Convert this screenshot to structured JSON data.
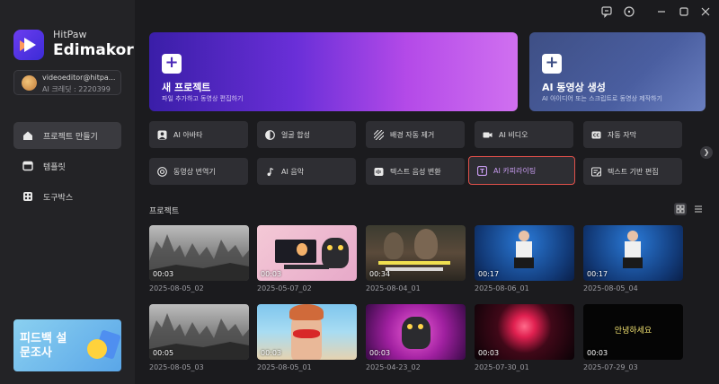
{
  "app": {
    "brand_top": "HitPaw",
    "brand_name": "Edimakor"
  },
  "account": {
    "email": "videoeditor@hitpa...",
    "credits": "AI 크레딧 : 2220399"
  },
  "titlebar": {
    "icons": [
      "feedback-icon",
      "help-icon",
      "minimize-icon",
      "maximize-icon",
      "close-icon"
    ]
  },
  "nav": {
    "items": [
      {
        "label": "프로젝트 만들기",
        "icon": "home-icon",
        "active": true
      },
      {
        "label": "템플릿",
        "icon": "template-icon",
        "active": false
      },
      {
        "label": "도구박스",
        "icon": "toolbox-icon",
        "active": false
      }
    ]
  },
  "feedback_banner": {
    "text": "피드백 설문조사"
  },
  "hero": {
    "new_project": {
      "title": "새 프로젝트",
      "subtitle": "파일 추가하고 동영상 편집하기"
    },
    "ai_video": {
      "title": "AI 동영상 생성",
      "subtitle": "AI 아이디어 또는 스크립트로 동영상 제작하기"
    }
  },
  "tools": {
    "row1": [
      {
        "label": "AI 아바타",
        "icon": "avatar-icon"
      },
      {
        "label": "얼굴 합성",
        "icon": "face-swap-icon"
      },
      {
        "label": "배경 자동 제거",
        "icon": "background-remove-icon"
      },
      {
        "label": "AI 비디오",
        "icon": "ai-video-icon"
      },
      {
        "label": "자동 자막",
        "icon": "caption-icon"
      }
    ],
    "row2": [
      {
        "label": "동영상 번역기",
        "icon": "translate-icon"
      },
      {
        "label": "AI 음악",
        "icon": "music-icon"
      },
      {
        "label": "텍스트 음성 변환",
        "icon": "text-to-speech-icon"
      },
      {
        "label": "AI 카피라이팅",
        "icon": "copywriting-icon",
        "highlighted": true
      },
      {
        "label": "텍스트 기반 편집",
        "icon": "text-edit-icon"
      }
    ]
  },
  "projects": {
    "title": "프로젝트",
    "items": [
      {
        "name": "2025-08-05_02",
        "duration": "00:03"
      },
      {
        "name": "2025-05-07_02",
        "duration": "00:03"
      },
      {
        "name": "2025-08-04_01",
        "duration": "00:34"
      },
      {
        "name": "2025-08-06_01",
        "duration": "00:17"
      },
      {
        "name": "2025-08-05_04",
        "duration": "00:17"
      },
      {
        "name": "2025-08-05_03",
        "duration": "00:05"
      },
      {
        "name": "2025-08-05_01",
        "duration": "00:03"
      },
      {
        "name": "2025-04-23_02",
        "duration": "00:03"
      },
      {
        "name": "2025-07-30_01",
        "duration": "00:03"
      },
      {
        "name": "2025-07-29_03",
        "duration": "00:03",
        "caption": "안녕하세요"
      }
    ]
  },
  "colors": {
    "accent": "#8b45e6",
    "highlight_border": "#e0504a",
    "background": "#1b1b1e",
    "sidebar": "#232326"
  }
}
